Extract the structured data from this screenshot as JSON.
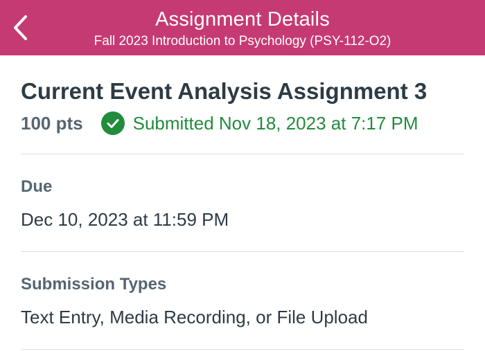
{
  "header": {
    "title": "Assignment Details",
    "subtitle": "Fall 2023 Introduction to Psychology (PSY-112-O2)",
    "background_color": "#c63a73",
    "back_icon": "chevron-left-icon"
  },
  "assignment": {
    "title": "Current Event Analysis Assignment 3",
    "points": "100 pts",
    "status": "Submitted Nov 18, 2023 at 7:17 PM",
    "status_color": "#228b3c",
    "status_icon": "check-circle-icon"
  },
  "sections": [
    {
      "label": "Due",
      "value": "Dec 10, 2023 at 11:59 PM"
    },
    {
      "label": "Submission Types",
      "value": "Text Entry, Media Recording, or File Upload"
    }
  ]
}
